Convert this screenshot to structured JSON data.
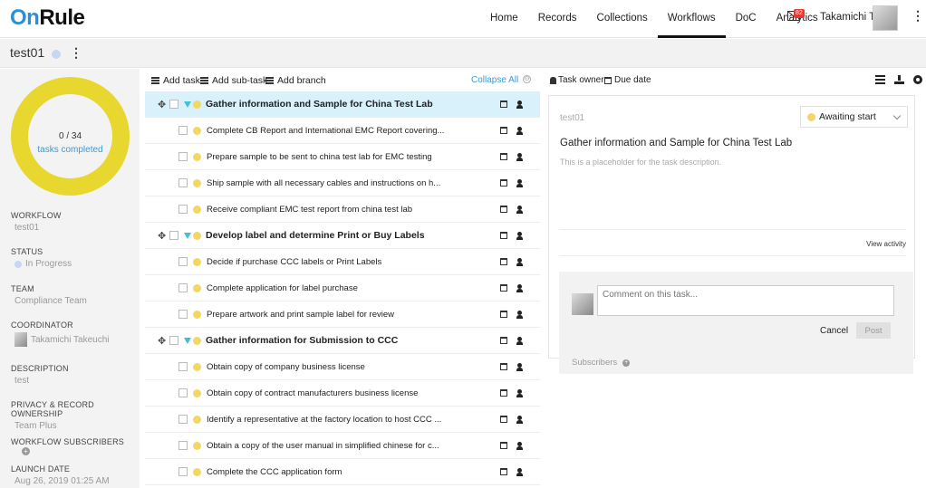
{
  "app": {
    "logo_on": "On",
    "logo_rule": "Rule"
  },
  "nav": {
    "items": [
      "Home",
      "Records",
      "Collections",
      "Workflows",
      "DoC",
      "Analytics"
    ],
    "mail_badge": "82",
    "user_name": "Takamichi T."
  },
  "workflow": {
    "title": "test01"
  },
  "sidebar": {
    "progress_count": "0 / 34",
    "progress_label": "tasks completed",
    "progress_fraction": 0,
    "fields": {
      "workflow_label": "WORKFLOW",
      "workflow_value": "test01",
      "status_label": "STATUS",
      "status_value": "In Progress",
      "team_label": "TEAM",
      "team_value": "Compliance Team",
      "coordinator_label": "COORDINATOR",
      "coordinator_value": "Takamichi Takeuchi",
      "description_label": "DESCRIPTION",
      "description_value": "test",
      "privacy_label": "PRIVACY & RECORD OWNERSHIP",
      "privacy_value": "Team Plus",
      "subscribers_label": "WORKFLOW SUBSCRIBERS",
      "launch_label": "LAUNCH DATE",
      "launch_value": "Aug 26, 2019 01:25 AM"
    }
  },
  "toolbar": {
    "add_task": "Add task",
    "add_subtask": "Add sub-task",
    "add_branch": "Add branch",
    "collapse_all": "Collapse All"
  },
  "tasks": [
    {
      "text": "Gather information and Sample for China Test Lab",
      "heading": true,
      "selected": true
    },
    {
      "text": "Complete CB Report and International EMC Report covering...",
      "heading": false
    },
    {
      "text": "Prepare sample to be sent to china test lab for EMC testing",
      "heading": false
    },
    {
      "text": "Ship sample with all necessary cables and instructions on h...",
      "heading": false
    },
    {
      "text": "Receive compliant EMC test report from china test lab",
      "heading": false
    },
    {
      "text": "Develop label and determine Print or Buy Labels",
      "heading": true
    },
    {
      "text": "Decide if purchase CCC labels or Print Labels",
      "heading": false
    },
    {
      "text": "Complete application for label purchase",
      "heading": false
    },
    {
      "text": "Prepare artwork and print sample label for review",
      "heading": false
    },
    {
      "text": "Gather information for Submission to CCC",
      "heading": true
    },
    {
      "text": "Obtain copy of company business license",
      "heading": false
    },
    {
      "text": "Obtain copy of contract manufacturers business license",
      "heading": false
    },
    {
      "text": "Identify a representative at the factory location to host CCC ...",
      "heading": false
    },
    {
      "text": "Obtain a copy of the user manual in simplified chinese for c...",
      "heading": false
    },
    {
      "text": "Complete the CCC application form",
      "heading": false
    }
  ],
  "detail": {
    "task_owner": "Task owner",
    "due_date": "Due date",
    "task_id": "test01",
    "status": "Awaiting start",
    "title": "Gather information and Sample for China Test Lab",
    "description": "This is a placeholder for the task description.",
    "view_activity": "View activity",
    "comment_placeholder": "Comment on this task...",
    "cancel": "Cancel",
    "post": "Post",
    "subscribers": "Subscribers"
  }
}
